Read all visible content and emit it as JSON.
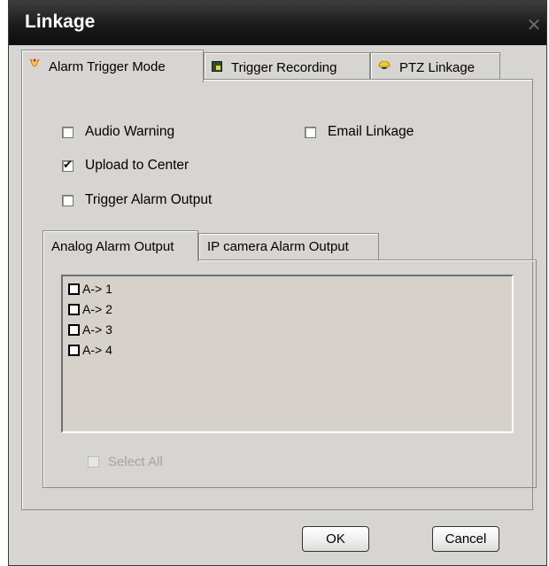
{
  "window": {
    "title": "Linkage",
    "close_glyph": "✕"
  },
  "tabs": [
    {
      "label": "Alarm Trigger Mode",
      "icon": "alarm-bell-icon"
    },
    {
      "label": "Trigger Recording",
      "icon": "recording-icon"
    },
    {
      "label": "PTZ Linkage",
      "icon": "ptz-dome-icon"
    }
  ],
  "options": {
    "audio_warning": {
      "label": "Audio Warning",
      "checked": false
    },
    "email_linkage": {
      "label": "Email Linkage",
      "checked": false
    },
    "upload_to_center": {
      "label": "Upload to Center",
      "checked": true
    },
    "trigger_alarm_output": {
      "label": "Trigger Alarm Output",
      "checked": false
    }
  },
  "subtabs": [
    {
      "label": "Analog Alarm Output"
    },
    {
      "label": "IP camera Alarm Output"
    }
  ],
  "alarm_outputs": [
    "A-> 1",
    "A-> 2",
    "A-> 3",
    "A-> 4"
  ],
  "select_all": {
    "label": "Select All",
    "enabled": false
  },
  "buttons": {
    "ok": "OK",
    "cancel": "Cancel"
  }
}
